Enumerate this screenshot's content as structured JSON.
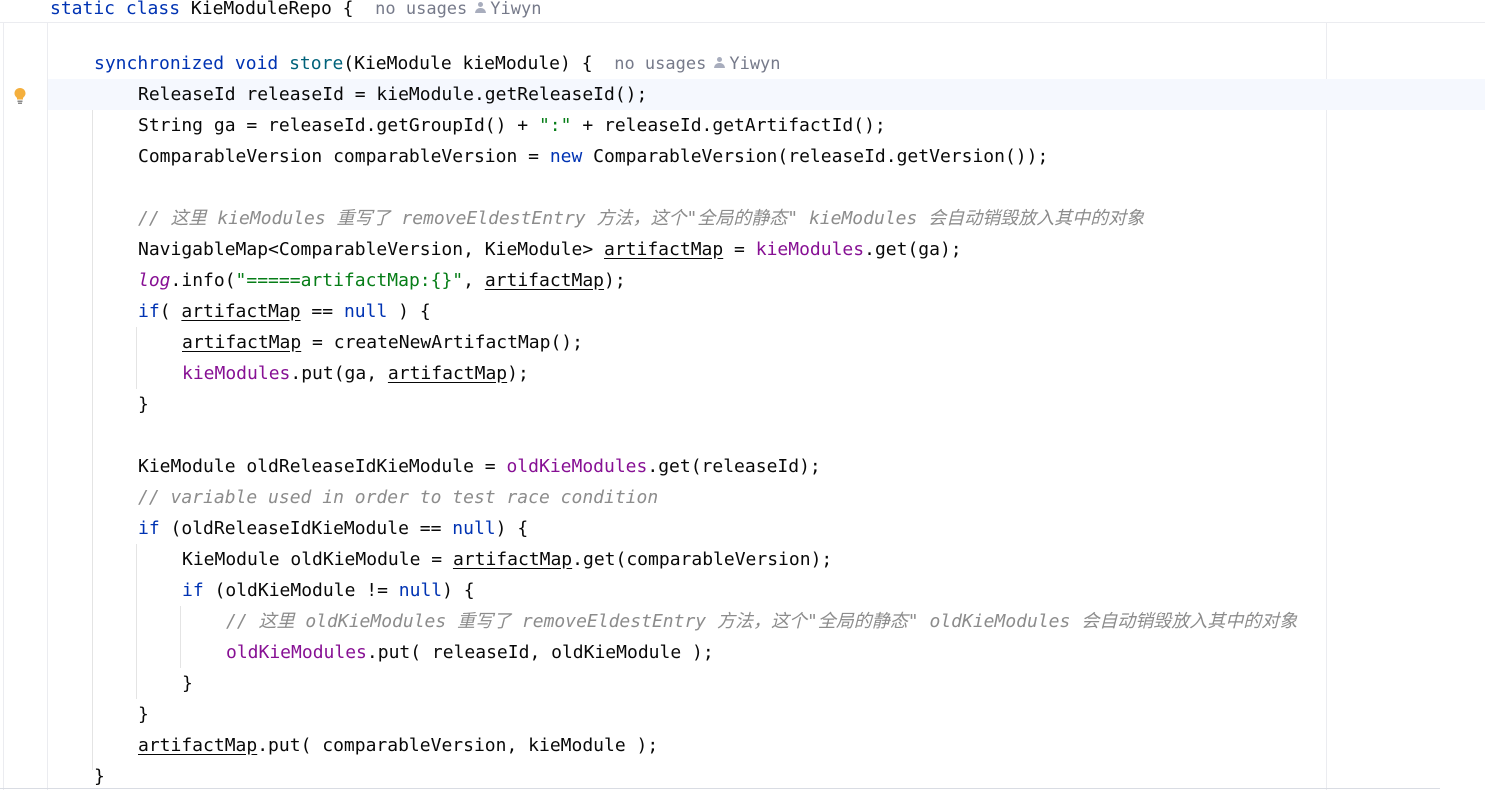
{
  "header": {
    "declaration": "static class KieModuleRepo {",
    "usages": "no usages",
    "author": "Yiwyn"
  },
  "method": {
    "signature": "synchronized void store(KieModule kieModule) {",
    "usages": "no usages",
    "author": "Yiwyn"
  },
  "code": {
    "l1": "ReleaseId releaseId = kieModule.getReleaseId();",
    "l2": "String ga = releaseId.getGroupId() + \":\" + releaseId.getArtifactId();",
    "l3": "ComparableVersion comparableVersion = new ComparableVersion(releaseId.getVersion());",
    "l4": "// 这里 kieModules 重写了 removeEldestEntry 方法，这个\"全局的静态\" kieModules 会自动销毁放入其中的对象",
    "l5": "NavigableMap<ComparableVersion, KieModule> artifactMap = kieModules.get(ga);",
    "l6": "log.info(\"=====artifactMap:{}\", artifactMap);",
    "l7": "if( artifactMap == null ) {",
    "l8": "artifactMap = createNewArtifactMap();",
    "l9": "kieModules.put(ga, artifactMap);",
    "l10": "}",
    "l11": "KieModule oldReleaseIdKieModule = oldKieModules.get(releaseId);",
    "l12": "// variable used in order to test race condition",
    "l13": "if (oldReleaseIdKieModule == null) {",
    "l14": "KieModule oldKieModule = artifactMap.get(comparableVersion);",
    "l15": "if (oldKieModule != null) {",
    "l16": "// 这里 oldKieModules 重写了 removeEldestEntry 方法，这个\"全局的静态\" oldKieModules 会自动销毁放入其中的对象",
    "l17": "oldKieModules.put( releaseId, oldKieModule );",
    "l18": "}",
    "l19": "}",
    "l20": "artifactMap.put( comparableVersion, kieModule );",
    "l21": "}"
  },
  "colors": {
    "keyword": "#0033b3",
    "method_decl": "#00627a",
    "string": "#067d17",
    "field": "#871094",
    "comment": "#8c8c8c",
    "caret_row": "#f5f8fe"
  },
  "icons": {
    "intention": "lightbulb-icon",
    "author": "user-icon"
  }
}
